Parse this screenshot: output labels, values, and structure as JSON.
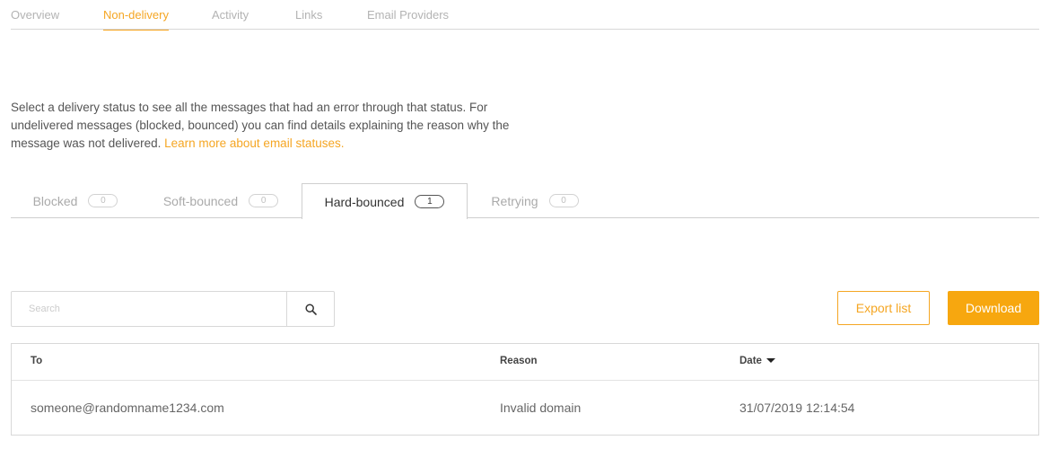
{
  "top_tabs": [
    {
      "label": "Overview",
      "active": false
    },
    {
      "label": "Non-delivery",
      "active": true
    },
    {
      "label": "Activity",
      "active": false
    },
    {
      "label": "Links",
      "active": false
    },
    {
      "label": "Email Providers",
      "active": false
    }
  ],
  "description": {
    "text": "Select a delivery status to see all the messages that had an error through that status. For undelivered messages (blocked, bounced) you can find details explaining the reason why the message was not delivered.",
    "link": "Learn more about email statuses."
  },
  "status_tabs": [
    {
      "label": "Blocked",
      "count": "0",
      "active": false
    },
    {
      "label": "Soft-bounced",
      "count": "0",
      "active": false
    },
    {
      "label": "Hard-bounced",
      "count": "1",
      "active": true
    },
    {
      "label": "Retrying",
      "count": "0",
      "active": false
    }
  ],
  "search": {
    "placeholder": "Search",
    "value": "",
    "icon": "search-icon"
  },
  "actions": {
    "export_label": "Export list",
    "download_label": "Download"
  },
  "table": {
    "columns": [
      "To",
      "Reason",
      "Date"
    ],
    "sort": {
      "column": "Date",
      "direction": "descending"
    },
    "rows": [
      {
        "to": "someone@randomname1234.com",
        "reason": "Invalid domain",
        "date": "31/07/2019 12:14:54"
      }
    ]
  },
  "colors": {
    "accent": "#f5a623",
    "accent_button": "#f7a70f"
  }
}
